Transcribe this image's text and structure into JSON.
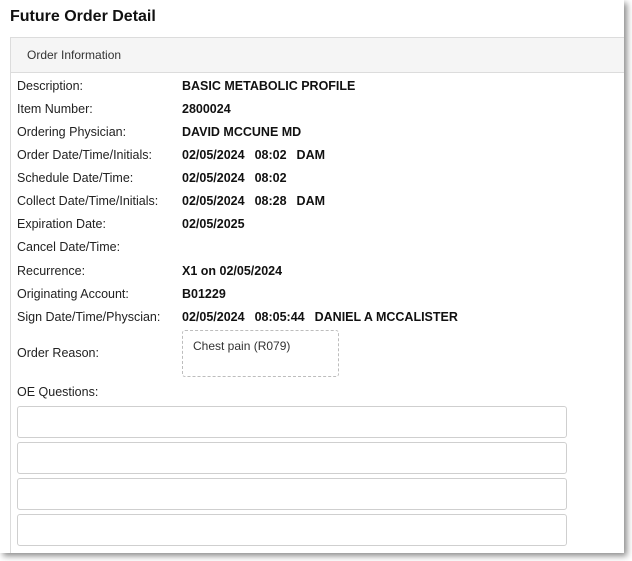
{
  "dialog": {
    "title": "Future Order Detail"
  },
  "panel": {
    "header": "Order Information"
  },
  "fields": [
    {
      "label": "Description:",
      "value": "BASIC METABOLIC PROFILE"
    },
    {
      "label": "Item Number:",
      "value": "2800024"
    },
    {
      "label": "Ordering Physician:",
      "value": "DAVID MCCUNE MD"
    },
    {
      "label": "Order Date/Time/Initials:",
      "parts": [
        "02/05/2024",
        "08:02",
        "DAM"
      ]
    },
    {
      "label": "Schedule Date/Time:",
      "parts": [
        "02/05/2024",
        "08:02"
      ]
    },
    {
      "label": "Collect Date/Time/Initials:",
      "parts": [
        "02/05/2024",
        "08:28",
        "DAM"
      ]
    },
    {
      "label": "Expiration Date:",
      "value": "02/05/2025"
    },
    {
      "label": "Cancel Date/Time:",
      "value": ""
    },
    {
      "label": "Recurrence:",
      "value": "X1 on 02/05/2024"
    },
    {
      "label": "Originating Account:",
      "value": "B01229"
    },
    {
      "label": "Sign Date/Time/Physcian:",
      "parts": [
        "02/05/2024",
        "08:05:44",
        "DANIEL A MCCALISTER"
      ]
    }
  ],
  "order_reason": {
    "label": "Order Reason:",
    "value": "Chest pain (R079)"
  },
  "oe_questions": {
    "label": "OE Questions:",
    "answers": [
      "",
      "",
      "",
      ""
    ]
  }
}
